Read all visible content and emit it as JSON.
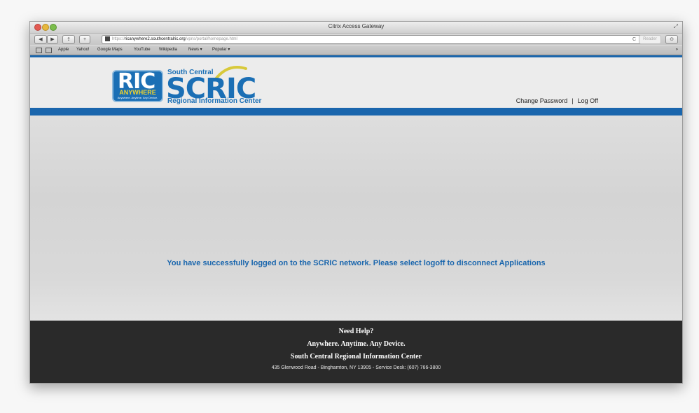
{
  "window": {
    "title": "Citrix Access Gateway",
    "resize_icon": "⤢"
  },
  "toolbar": {
    "back": "◀",
    "forward": "▶",
    "share": "⇪",
    "add": "+",
    "url_prefix": "https://",
    "url_host": "ricanywhere2.southcentralric.org",
    "url_path": "/vpns/portal/homepage.html",
    "refresh": "C",
    "reader": "Reader",
    "download_icon": "⊙"
  },
  "bookmarks": {
    "items": [
      "Apple",
      "Yahoo!",
      "Google Maps",
      "YouTube",
      "Wikipedia",
      "News ▾",
      "Popular ▾"
    ],
    "more": "»"
  },
  "logo": {
    "ric": "RIC",
    "anywhere": "ANYWHERE",
    "tagline": "Anywhere. Anytime. Any Device.",
    "south_central": "South Central",
    "scric": "SCRIC",
    "regional": "Regional Information Center"
  },
  "header": {
    "change_password": "Change Password",
    "separator": "|",
    "log_off": "Log Off"
  },
  "main": {
    "message": "You have successfully logged on to the SCRIC network. Please select logoff to disconnect Applications"
  },
  "footer": {
    "need_help": "Need Help?",
    "slogan": "Anywhere. Anytime. Any Device.",
    "org": "South Central Regional Information Center",
    "address": "435 Glenwood Road - Binghamton, NY 13905 - Service Desk: (607) 766-3800"
  },
  "colors": {
    "brand_blue": "#1a66ad",
    "logo_yellow": "#f2d42a",
    "footer_bg": "#2a2a2a"
  }
}
